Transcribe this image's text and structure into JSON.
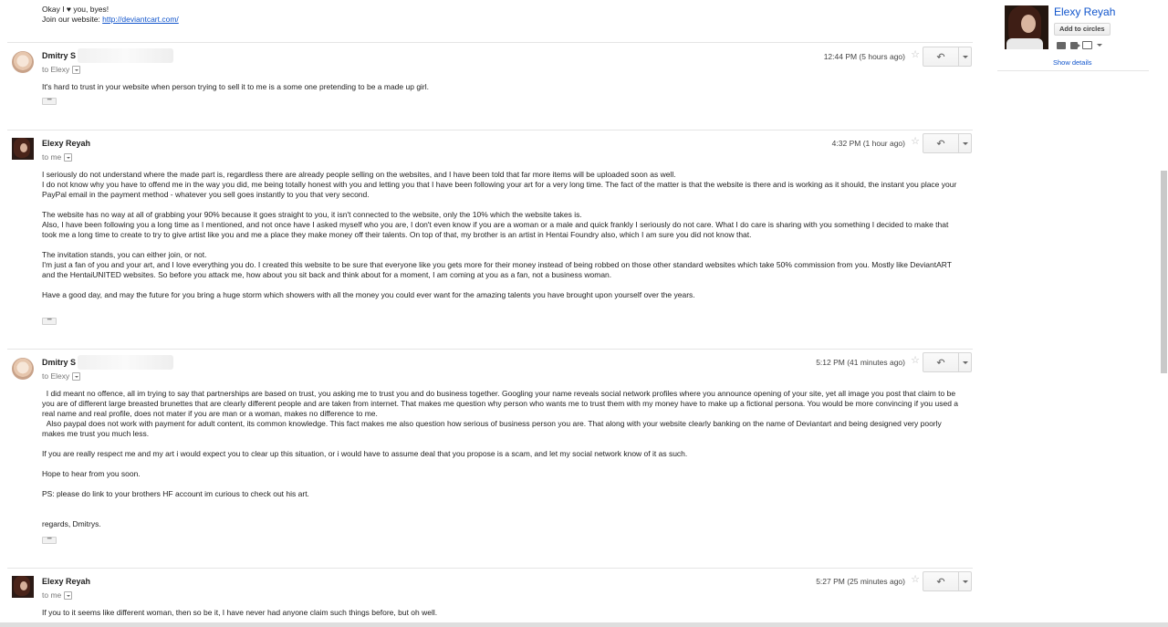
{
  "top_tail": {
    "line1": "Okay I ♥ you, byes!",
    "line2_prefix": "Join our website: ",
    "link": "http://deviantcart.com/"
  },
  "messages": [
    {
      "sender": "Dmitry S",
      "to": "to Elexy",
      "time": "12:44 PM (5 hours ago)",
      "body": [
        "It's hard to trust in your website when person trying to sell it to me is a some one pretending to be a made up girl."
      ]
    },
    {
      "sender": "Elexy Reyah",
      "to": "to me",
      "time": "4:32 PM (1 hour ago)",
      "body": [
        "I seriously do not understand where the made part is, regardless there are already people selling on the websites, and I have been told that far more items will be uploaded soon as well.\nI do not know why you have to offend me in the way you did, me being totally honest with you and letting you that I have been following your art for a very long time. The fact of the matter is that the website is there and is working as it should, the instant you place your PayPal email in the payment method - whatever you sell goes instantly to you that very second.",
        "The website has no way at all of grabbing your 90% because it goes straight to you, it isn't connected to the website, only the 10% which the website takes is.\nAlso, I have been following you a long time as I mentioned, and not once have I asked myself who you are, I don't even know if you are a woman or a male and quick frankly I seriously do not care. What I do care is sharing with you something I decided to make that took me a long time to create to try to give artist like you and me a place they make money off their talents. On top of that, my brother is an artist in Hentai Foundry also, which I am sure you did not know that.",
        "The invitation stands, you can either join, or not.\nI'm just a fan of you and your art, and I love everything you do. I created this website to be sure that everyone like you gets more for their money instead of being robbed on those other standard websites which take 50% commission from you. Mostly like DeviantART and the HentaiUNITED websites. So before you attack me, how about you sit back and think about for a moment, I am coming at you as a fan, not a business woman.",
        "Have a good day, and may the future for you bring a huge storm which showers with all the money you could ever want for the amazing talents you have brought upon yourself over the years."
      ]
    },
    {
      "sender": "Dmitry S",
      "to": "to Elexy",
      "time": "5:12 PM (41 minutes ago)",
      "body": [
        "  I did meant no offence, all im trying to say that partnerships are based on trust, you asking me to trust you and do business together. Googling your name reveals social network profiles where you announce opening of your site, yet all image you post that claim to be you are of different large breasted brunettes that are clearly different people and are taken from internet. That makes me question why person who wants me to trust them with my money have to make up a fictional persona. You would be more convincing if you used a real name and real profile, does not mater if you are man or a woman, makes no difference to me.\n  Also paypal does not work with payment for adult content, its common knowledge. This fact makes me also question how serious of business person you are. That along with your website clearly banking on the name of Deviantart and being designed very poorly makes me trust you much less.",
        "If you are really respect me and my art i would expect you to clear up this situation, or i would have to assume deal that you propose is a scam, and let my social network know of it as such.",
        "Hope to hear from you soon.",
        "PS: please do link to your brothers HF account im curious to check out his art.",
        "\nregards, Dmitrys."
      ]
    },
    {
      "sender": "Elexy Reyah",
      "to": "to me",
      "time": "5:27 PM (25 minutes ago)",
      "body": [
        "If you to it seems like different woman, then so be it, I have never had anyone claim such things before, but oh well."
      ]
    }
  ],
  "contact_card": {
    "name": "Elexy Reyah",
    "add_button": "Add to circles",
    "show_details": "Show details"
  },
  "icons": [
    "reply-arrow-icon",
    "more-caret-icon",
    "star-icon",
    "chat-icon",
    "video-icon",
    "mail-icon"
  ]
}
